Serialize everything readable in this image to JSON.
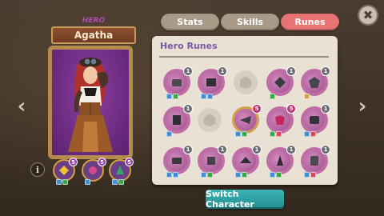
{
  "tabs": [
    {
      "label": "Stats",
      "active": false
    },
    {
      "label": "Skills",
      "active": false
    },
    {
      "label": "Runes",
      "active": true
    }
  ],
  "hero": {
    "class_label": "HERO",
    "name": "Agatha",
    "equipped_runes": [
      {
        "level": "5",
        "tags": [
          "b",
          "g"
        ]
      },
      {
        "level": "5",
        "tags": [
          "b"
        ]
      },
      {
        "level": "5",
        "tags": [
          "b",
          "g"
        ]
      }
    ]
  },
  "panel": {
    "title": "Hero Runes",
    "rows": [
      [
        {
          "level": "1",
          "tags": [
            "b",
            "g"
          ]
        },
        {
          "level": "1",
          "tags": [
            "b",
            "b"
          ]
        },
        {
          "empty": true
        },
        {
          "level": "1",
          "tags": [
            "g"
          ]
        },
        {
          "level": "1",
          "tags": [
            "y"
          ]
        }
      ],
      [
        {
          "level": "1",
          "tags": [
            "b"
          ]
        },
        {
          "empty": true
        },
        {
          "level": "5",
          "tags": [
            "b",
            "g"
          ],
          "highlight": true
        },
        {
          "level": "5",
          "tags": [
            "g",
            "r"
          ],
          "highlight": true
        },
        {
          "level": "1",
          "tags": [
            "b",
            "r"
          ]
        }
      ],
      [
        {
          "level": "1",
          "tags": [
            "b",
            "b"
          ]
        },
        {
          "level": "1",
          "tags": [
            "b",
            "g"
          ]
        },
        {
          "level": "1",
          "tags": [
            "b",
            "g"
          ]
        },
        {
          "level": "1",
          "tags": [
            "b",
            "g"
          ]
        },
        {
          "level": "1",
          "tags": [
            "b",
            "r"
          ]
        }
      ]
    ]
  },
  "buttons": {
    "switch_character": "Switch Character",
    "close_glyph": "✖",
    "info_glyph": "i",
    "prev_glyph": "‹",
    "next_glyph": "›"
  },
  "colors": {
    "active_tab": "#e77472",
    "inactive_tab": "#a79a86",
    "switch_button": "#2aa0a2",
    "panel_title": "#7a5aa4"
  }
}
